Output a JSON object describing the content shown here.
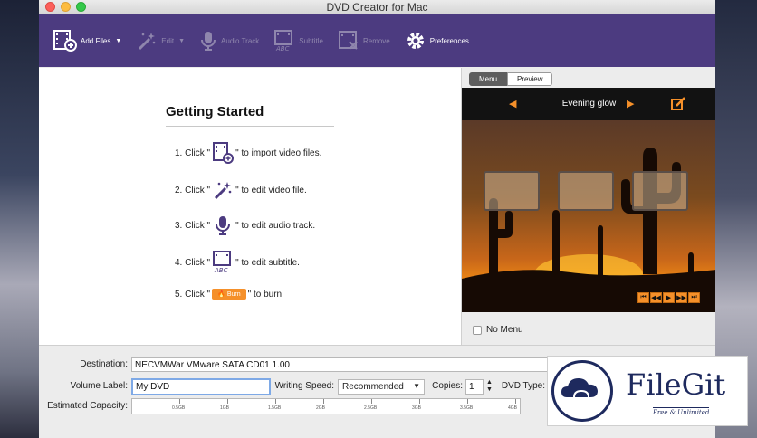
{
  "window": {
    "title": "DVD Creator for Mac"
  },
  "toolbar": {
    "add_files": "Add Files",
    "edit": "Edit",
    "audio_track": "Audio Track",
    "subtitle": "Subtitle",
    "remove": "Remove",
    "preferences": "Preferences"
  },
  "getting_started": {
    "title": "Getting Started",
    "step1_prefix": "1. Click \"",
    "step1_suffix": "\" to import video files.",
    "step2_prefix": "2. Click \"",
    "step2_suffix": "\" to edit video file.",
    "step3_prefix": "3. Click \"",
    "step3_suffix": "\" to edit audio track.",
    "step4_prefix": "4. Click \"",
    "step4_suffix": "\" to edit subtitle.",
    "step5_prefix": "5. Click \"",
    "step5_suffix": "\" to burn.",
    "burn_label": "Burn"
  },
  "preview": {
    "tab_menu": "Menu",
    "tab_preview": "Preview",
    "theme_name": "Evening glow",
    "no_menu_label": "No Menu",
    "no_menu_checked": false
  },
  "settings": {
    "destination_label": "Destination:",
    "destination_value": "NECVMWar VMware SATA CD01 1.00",
    "volume_label": "Volume Label:",
    "volume_value": "My DVD",
    "writing_speed_label": "Writing Speed:",
    "writing_speed_value": "Recommended",
    "copies_label": "Copies:",
    "copies_value": "1",
    "dvd_type_label": "DVD Type:",
    "capacity_label": "Estimated Capacity:",
    "capacity_ticks": [
      "0.5GB",
      "1GB",
      "1.5GB",
      "2GB",
      "2.5GB",
      "3GB",
      "3.5GB",
      "4GB",
      "4.5GB"
    ]
  },
  "watermark": {
    "brand": "FileGit",
    "tagline": "Free & Unlimited"
  },
  "colors": {
    "toolbar_bg": "#4c3b80",
    "accent_orange": "#f5902a"
  }
}
